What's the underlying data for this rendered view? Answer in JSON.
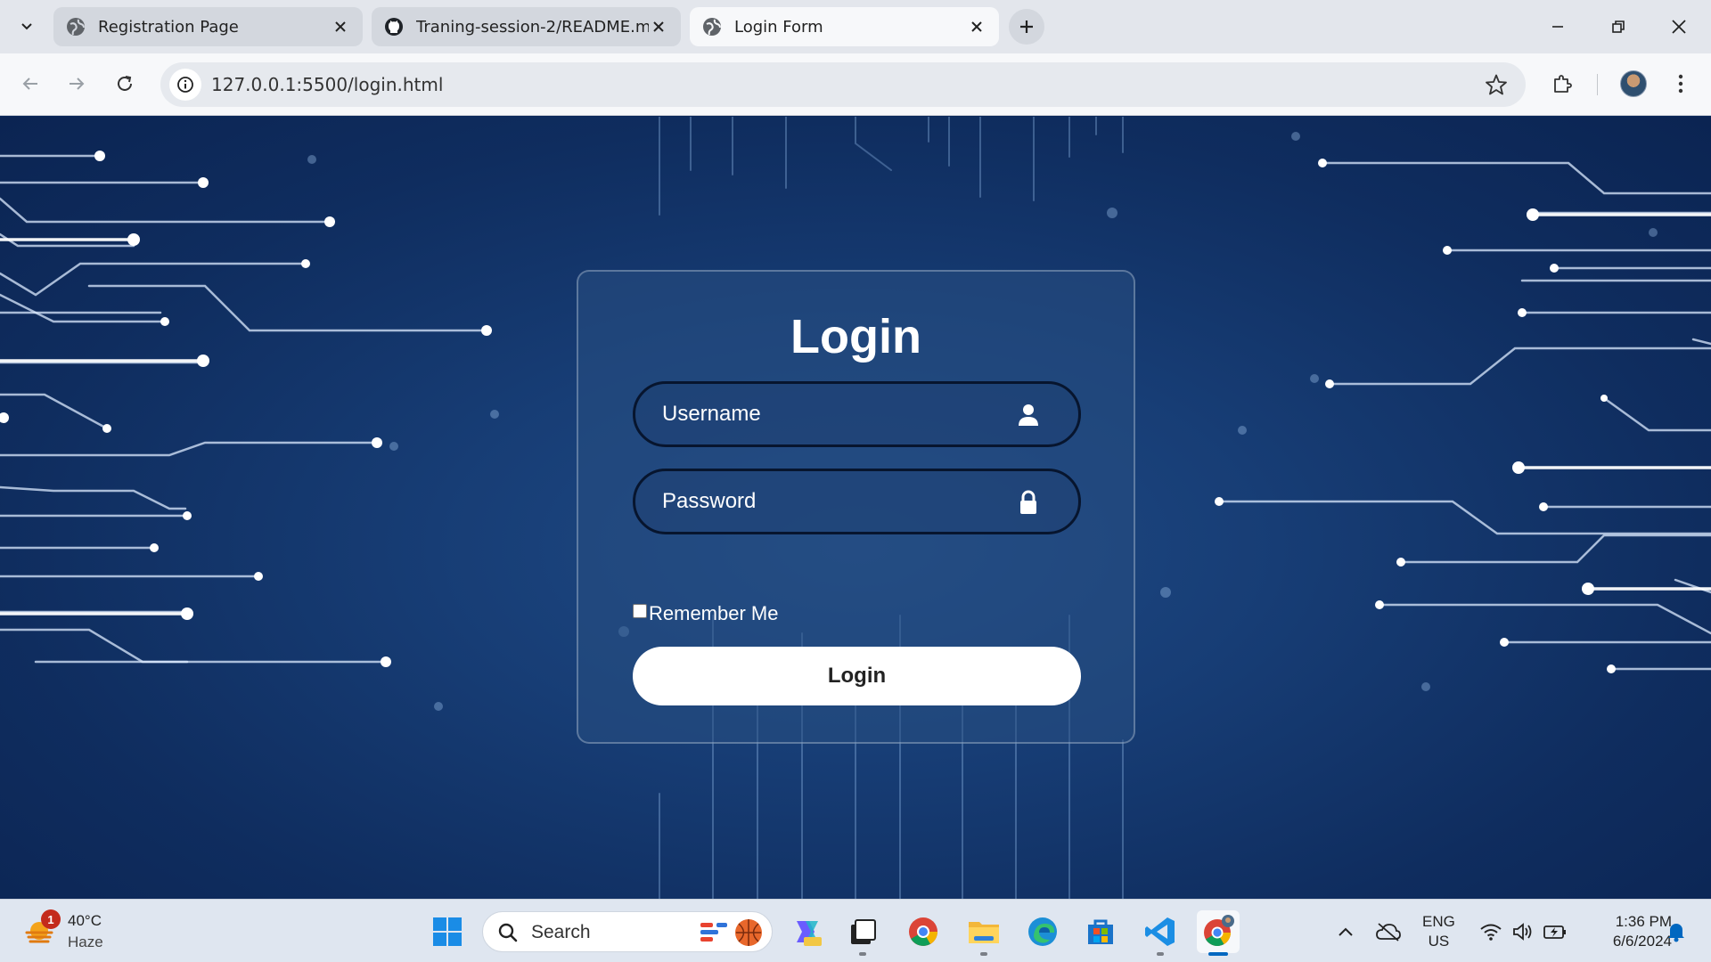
{
  "browser": {
    "tabs": [
      {
        "title": "Registration Page",
        "favicon": "globe-icon",
        "active": false
      },
      {
        "title": "Traning-session-2/README.md",
        "favicon": "github-icon",
        "active": false
      },
      {
        "title": "Login Form",
        "favicon": "globe-icon",
        "active": true
      }
    ],
    "url": "127.0.0.1:5500/login.html"
  },
  "login": {
    "title": "Login",
    "username_placeholder": "Username",
    "password_placeholder": "Password",
    "remember_label": "Remember Me",
    "button_label": "Login"
  },
  "taskbar": {
    "weather": {
      "temp": "40°C",
      "condition": "Haze",
      "badge": "1"
    },
    "search_placeholder": "Search",
    "language": {
      "line1": "ENG",
      "line2": "US"
    },
    "time": "1:36 PM",
    "date": "6/6/2024"
  },
  "colors": {
    "page_background": "#173d75",
    "card_border": "#ffffff",
    "input_border": "#07152e",
    "button_background": "#ffffff",
    "taskbar_background": "#dfe6f0"
  }
}
